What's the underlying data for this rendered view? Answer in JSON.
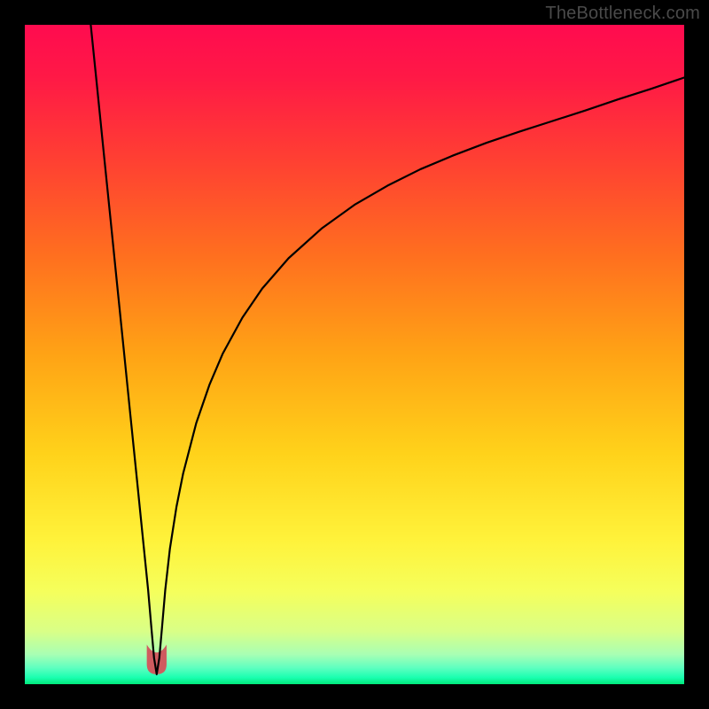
{
  "watermark": {
    "text": "TheBottleneck.com"
  },
  "colors": {
    "frame": "#000000",
    "curve": "#000000",
    "highlight_fill": "#cf5b5f",
    "gradient_stops": [
      {
        "offset": 0.0,
        "color": "#ff0b4f"
      },
      {
        "offset": 0.08,
        "color": "#ff1946"
      },
      {
        "offset": 0.2,
        "color": "#ff3e33"
      },
      {
        "offset": 0.35,
        "color": "#ff6f1f"
      },
      {
        "offset": 0.5,
        "color": "#ffa315"
      },
      {
        "offset": 0.65,
        "color": "#ffd21a"
      },
      {
        "offset": 0.78,
        "color": "#fff23a"
      },
      {
        "offset": 0.86,
        "color": "#f5ff5c"
      },
      {
        "offset": 0.92,
        "color": "#d9ff87"
      },
      {
        "offset": 0.955,
        "color": "#a8ffb4"
      },
      {
        "offset": 0.975,
        "color": "#5fffc0"
      },
      {
        "offset": 0.99,
        "color": "#1affb0"
      },
      {
        "offset": 1.0,
        "color": "#00e87a"
      }
    ]
  },
  "chart_data": {
    "type": "line",
    "title": "",
    "xlabel": "",
    "ylabel": "",
    "xlim": [
      0,
      100
    ],
    "ylim": [
      0,
      100
    ],
    "x_at_min": 20,
    "y_min": 1.5,
    "highlight_region": {
      "x_start": 18.5,
      "x_end": 21.5,
      "y_top": 6
    },
    "right_endpoint_y": 92,
    "series": [
      {
        "name": "curve",
        "points": [
          {
            "x": 10.0,
            "y": 100.0
          },
          {
            "x": 11.0,
            "y": 90.2
          },
          {
            "x": 12.0,
            "y": 80.3
          },
          {
            "x": 13.0,
            "y": 70.5
          },
          {
            "x": 14.0,
            "y": 60.6
          },
          {
            "x": 15.0,
            "y": 50.8
          },
          {
            "x": 16.0,
            "y": 40.9
          },
          {
            "x": 17.0,
            "y": 31.1
          },
          {
            "x": 18.0,
            "y": 21.2
          },
          {
            "x": 18.7,
            "y": 14.3
          },
          {
            "x": 19.2,
            "y": 8.5
          },
          {
            "x": 19.6,
            "y": 4.0
          },
          {
            "x": 20.0,
            "y": 1.5
          },
          {
            "x": 20.4,
            "y": 4.0
          },
          {
            "x": 20.8,
            "y": 8.5
          },
          {
            "x": 21.3,
            "y": 14.3
          },
          {
            "x": 22.0,
            "y": 20.5
          },
          {
            "x": 23.0,
            "y": 26.9
          },
          {
            "x": 24.0,
            "y": 31.9
          },
          {
            "x": 26.0,
            "y": 39.6
          },
          {
            "x": 28.0,
            "y": 45.4
          },
          {
            "x": 30.0,
            "y": 50.1
          },
          {
            "x": 33.0,
            "y": 55.6
          },
          {
            "x": 36.0,
            "y": 60.0
          },
          {
            "x": 40.0,
            "y": 64.6
          },
          {
            "x": 45.0,
            "y": 69.1
          },
          {
            "x": 50.0,
            "y": 72.7
          },
          {
            "x": 55.0,
            "y": 75.6
          },
          {
            "x": 60.0,
            "y": 78.1
          },
          {
            "x": 65.0,
            "y": 80.2
          },
          {
            "x": 70.0,
            "y": 82.1
          },
          {
            "x": 75.0,
            "y": 83.8
          },
          {
            "x": 80.0,
            "y": 85.4
          },
          {
            "x": 85.0,
            "y": 87.0
          },
          {
            "x": 90.0,
            "y": 88.7
          },
          {
            "x": 95.0,
            "y": 90.3
          },
          {
            "x": 100.0,
            "y": 92.0
          }
        ]
      }
    ]
  }
}
